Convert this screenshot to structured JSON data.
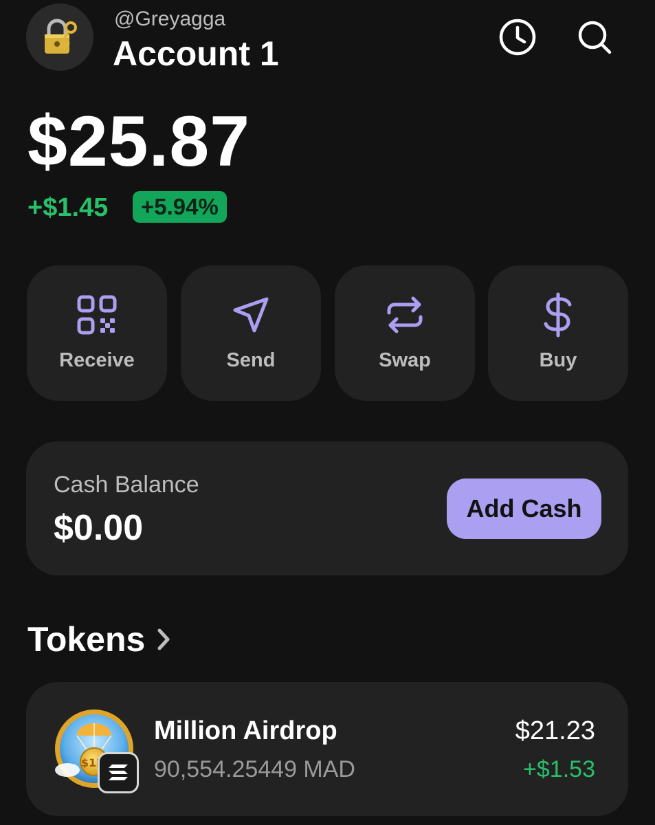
{
  "header": {
    "handle": "@Greyagga",
    "account_name": "Account 1",
    "avatar_icon": "lock-key-icon"
  },
  "balance": {
    "total": "$25.87",
    "change_abs": "+$1.45",
    "change_pct": "+5.94%"
  },
  "actions": [
    {
      "label": "Receive",
      "icon": "qr-code-icon"
    },
    {
      "label": "Send",
      "icon": "paper-plane-icon"
    },
    {
      "label": "Swap",
      "icon": "swap-arrows-icon"
    },
    {
      "label": "Buy",
      "icon": "dollar-icon"
    }
  ],
  "cash": {
    "label": "Cash Balance",
    "value": "$0.00",
    "button_label": "Add Cash"
  },
  "tokens": {
    "heading": "Tokens",
    "items": [
      {
        "name": "Million Airdrop",
        "amount": "90,554.25449 MAD",
        "value": "$21.23",
        "change": "+$1.53"
      }
    ]
  },
  "colors": {
    "background": "#121212",
    "card": "#222222",
    "accent": "#ab9ff2",
    "positive": "#29c06a"
  }
}
